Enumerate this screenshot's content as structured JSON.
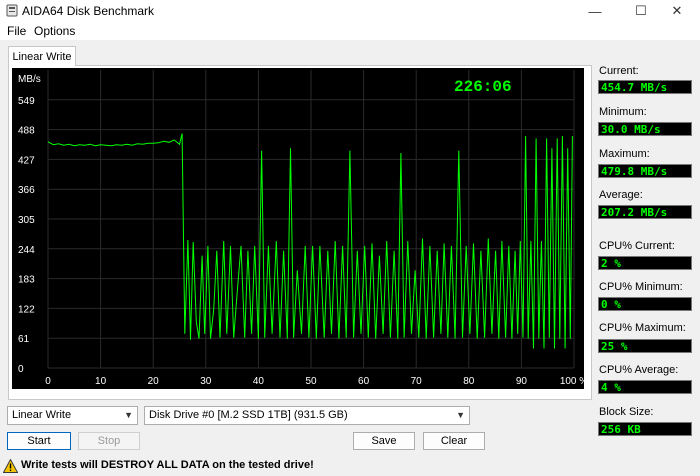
{
  "window": {
    "title": "AIDA64 Disk Benchmark",
    "minimize": "—",
    "maximize": "☐",
    "close": "✕"
  },
  "menu": {
    "file": "File",
    "options": "Options"
  },
  "tab": {
    "label": "Linear Write"
  },
  "chart": {
    "unit_label": "MB/s",
    "timer": "226:06",
    "colors": {
      "background": "#000000",
      "grid": "#2a2a2a",
      "line": "#00ff00",
      "timer": "#00ff00"
    }
  },
  "chart_data": {
    "type": "line",
    "title": "",
    "xlabel": "",
    "ylabel": "MB/s",
    "xlim": [
      0,
      100
    ],
    "ylim": [
      0,
      610
    ],
    "y_ticks": [
      "0",
      "61",
      "122",
      "183",
      "244",
      "305",
      "366",
      "427",
      "488",
      "549"
    ],
    "x_ticks": [
      "0",
      "10",
      "20",
      "30",
      "40",
      "50",
      "60",
      "70",
      "80",
      "90",
      "100 %"
    ],
    "series": [
      {
        "values": [
          [
            0,
            463
          ],
          [
            1,
            457
          ],
          [
            2,
            459
          ],
          [
            3,
            456
          ],
          [
            4,
            458
          ],
          [
            5,
            455
          ],
          [
            6,
            457
          ],
          [
            7,
            456
          ],
          [
            8,
            458
          ],
          [
            9,
            455
          ],
          [
            10,
            457
          ],
          [
            11,
            456
          ],
          [
            12,
            455
          ],
          [
            13,
            457
          ],
          [
            14,
            456
          ],
          [
            15,
            458
          ],
          [
            16,
            456
          ],
          [
            17,
            459
          ],
          [
            18,
            458
          ],
          [
            19,
            460
          ],
          [
            20,
            460
          ],
          [
            21,
            461
          ],
          [
            22,
            464
          ],
          [
            23,
            462
          ],
          [
            24,
            467
          ],
          [
            25,
            458
          ],
          [
            25.5,
            480
          ],
          [
            26,
            70
          ],
          [
            26.6,
            262
          ],
          [
            27.1,
            58
          ],
          [
            27.6,
            258
          ],
          [
            28.2,
            95
          ],
          [
            28.7,
            60
          ],
          [
            29.3,
            230
          ],
          [
            29.8,
            70
          ],
          [
            30.4,
            250
          ],
          [
            30.9,
            60
          ],
          [
            31.5,
            120
          ],
          [
            32.1,
            240
          ],
          [
            32.7,
            62
          ],
          [
            33.4,
            260
          ],
          [
            34,
            70
          ],
          [
            34.7,
            250
          ],
          [
            35.3,
            62
          ],
          [
            36,
            160
          ],
          [
            36.7,
            250
          ],
          [
            37.4,
            62
          ],
          [
            38,
            240
          ],
          [
            38.7,
            70
          ],
          [
            39.3,
            250
          ],
          [
            40,
            60
          ],
          [
            40.6,
            445
          ],
          [
            41.2,
            62
          ],
          [
            41.9,
            250
          ],
          [
            42.6,
            70
          ],
          [
            43.4,
            260
          ],
          [
            44.1,
            62
          ],
          [
            44.8,
            240
          ],
          [
            45.5,
            60
          ],
          [
            46.1,
            450
          ],
          [
            46.7,
            62
          ],
          [
            47.4,
            200
          ],
          [
            48.2,
            70
          ],
          [
            48.9,
            250
          ],
          [
            49.6,
            62
          ],
          [
            50.3,
            250
          ],
          [
            51,
            60
          ],
          [
            51.7,
            250
          ],
          [
            52.5,
            62
          ],
          [
            53.2,
            240
          ],
          [
            53.9,
            70
          ],
          [
            54.6,
            260
          ],
          [
            55.3,
            60
          ],
          [
            56,
            250
          ],
          [
            56.7,
            62
          ],
          [
            57.4,
            445
          ],
          [
            58.1,
            62
          ],
          [
            58.8,
            240
          ],
          [
            59.5,
            70
          ],
          [
            60.2,
            250
          ],
          [
            60.9,
            62
          ],
          [
            61.6,
            255
          ],
          [
            62.3,
            60
          ],
          [
            63,
            230
          ],
          [
            63.7,
            70
          ],
          [
            64.4,
            260
          ],
          [
            65.1,
            62
          ],
          [
            65.8,
            240
          ],
          [
            66.5,
            60
          ],
          [
            67.1,
            440
          ],
          [
            67.7,
            62
          ],
          [
            68.4,
            260
          ],
          [
            69.1,
            70
          ],
          [
            69.8,
            200
          ],
          [
            70.5,
            62
          ],
          [
            71.2,
            265
          ],
          [
            71.9,
            60
          ],
          [
            72.6,
            250
          ],
          [
            73.3,
            62
          ],
          [
            74,
            240
          ],
          [
            74.7,
            70
          ],
          [
            75.3,
            255
          ],
          [
            76,
            62
          ],
          [
            76.7,
            250
          ],
          [
            77.4,
            60
          ],
          [
            78.1,
            445
          ],
          [
            78.8,
            62
          ],
          [
            79.5,
            250
          ],
          [
            80.2,
            70
          ],
          [
            80.9,
            255
          ],
          [
            81.6,
            60
          ],
          [
            82.3,
            240
          ],
          [
            83,
            62
          ],
          [
            83.7,
            265
          ],
          [
            84.4,
            70
          ],
          [
            85.1,
            240
          ],
          [
            85.7,
            60
          ],
          [
            86.3,
            260
          ],
          [
            87,
            62
          ],
          [
            87.6,
            250
          ],
          [
            88.2,
            60
          ],
          [
            88.8,
            240
          ],
          [
            89.3,
            70
          ],
          [
            89.8,
            260
          ],
          [
            90.3,
            62
          ],
          [
            90.8,
            475
          ],
          [
            91.3,
            60
          ],
          [
            91.8,
            260
          ],
          [
            92.3,
            40
          ],
          [
            92.8,
            470
          ],
          [
            93.3,
            60
          ],
          [
            93.8,
            260
          ],
          [
            94.3,
            40
          ],
          [
            94.8,
            470
          ],
          [
            95.3,
            62
          ],
          [
            95.8,
            450
          ],
          [
            96.3,
            40
          ],
          [
            96.8,
            470
          ],
          [
            97.3,
            60
          ],
          [
            97.8,
            475
          ],
          [
            98.3,
            40
          ],
          [
            98.8,
            450
          ],
          [
            99.3,
            60
          ],
          [
            99.7,
            475
          ]
        ]
      }
    ]
  },
  "stats": {
    "current_label": "Current:",
    "current_value": "454.7 MB/s",
    "minimum_label": "Minimum:",
    "minimum_value": "30.0 MB/s",
    "maximum_label": "Maximum:",
    "maximum_value": "479.8 MB/s",
    "average_label": "Average:",
    "average_value": "207.2 MB/s",
    "cpu_current_label": "CPU% Current:",
    "cpu_current_value": "2 %",
    "cpu_minimum_label": "CPU% Minimum:",
    "cpu_minimum_value": "0 %",
    "cpu_maximum_label": "CPU% Maximum:",
    "cpu_maximum_value": "25 %",
    "cpu_average_label": "CPU% Average:",
    "cpu_average_value": "4 %",
    "block_size_label": "Block Size:",
    "block_size_value": "256 KB"
  },
  "controls": {
    "test_select": "Linear Write",
    "drive_select": "Disk Drive #0  [M.2 SSD 1TB]  (931.5 GB)",
    "start": "Start",
    "stop": "Stop",
    "save": "Save",
    "clear": "Clear"
  },
  "warning": {
    "text": "Write tests will DESTROY ALL DATA on the tested drive!"
  }
}
